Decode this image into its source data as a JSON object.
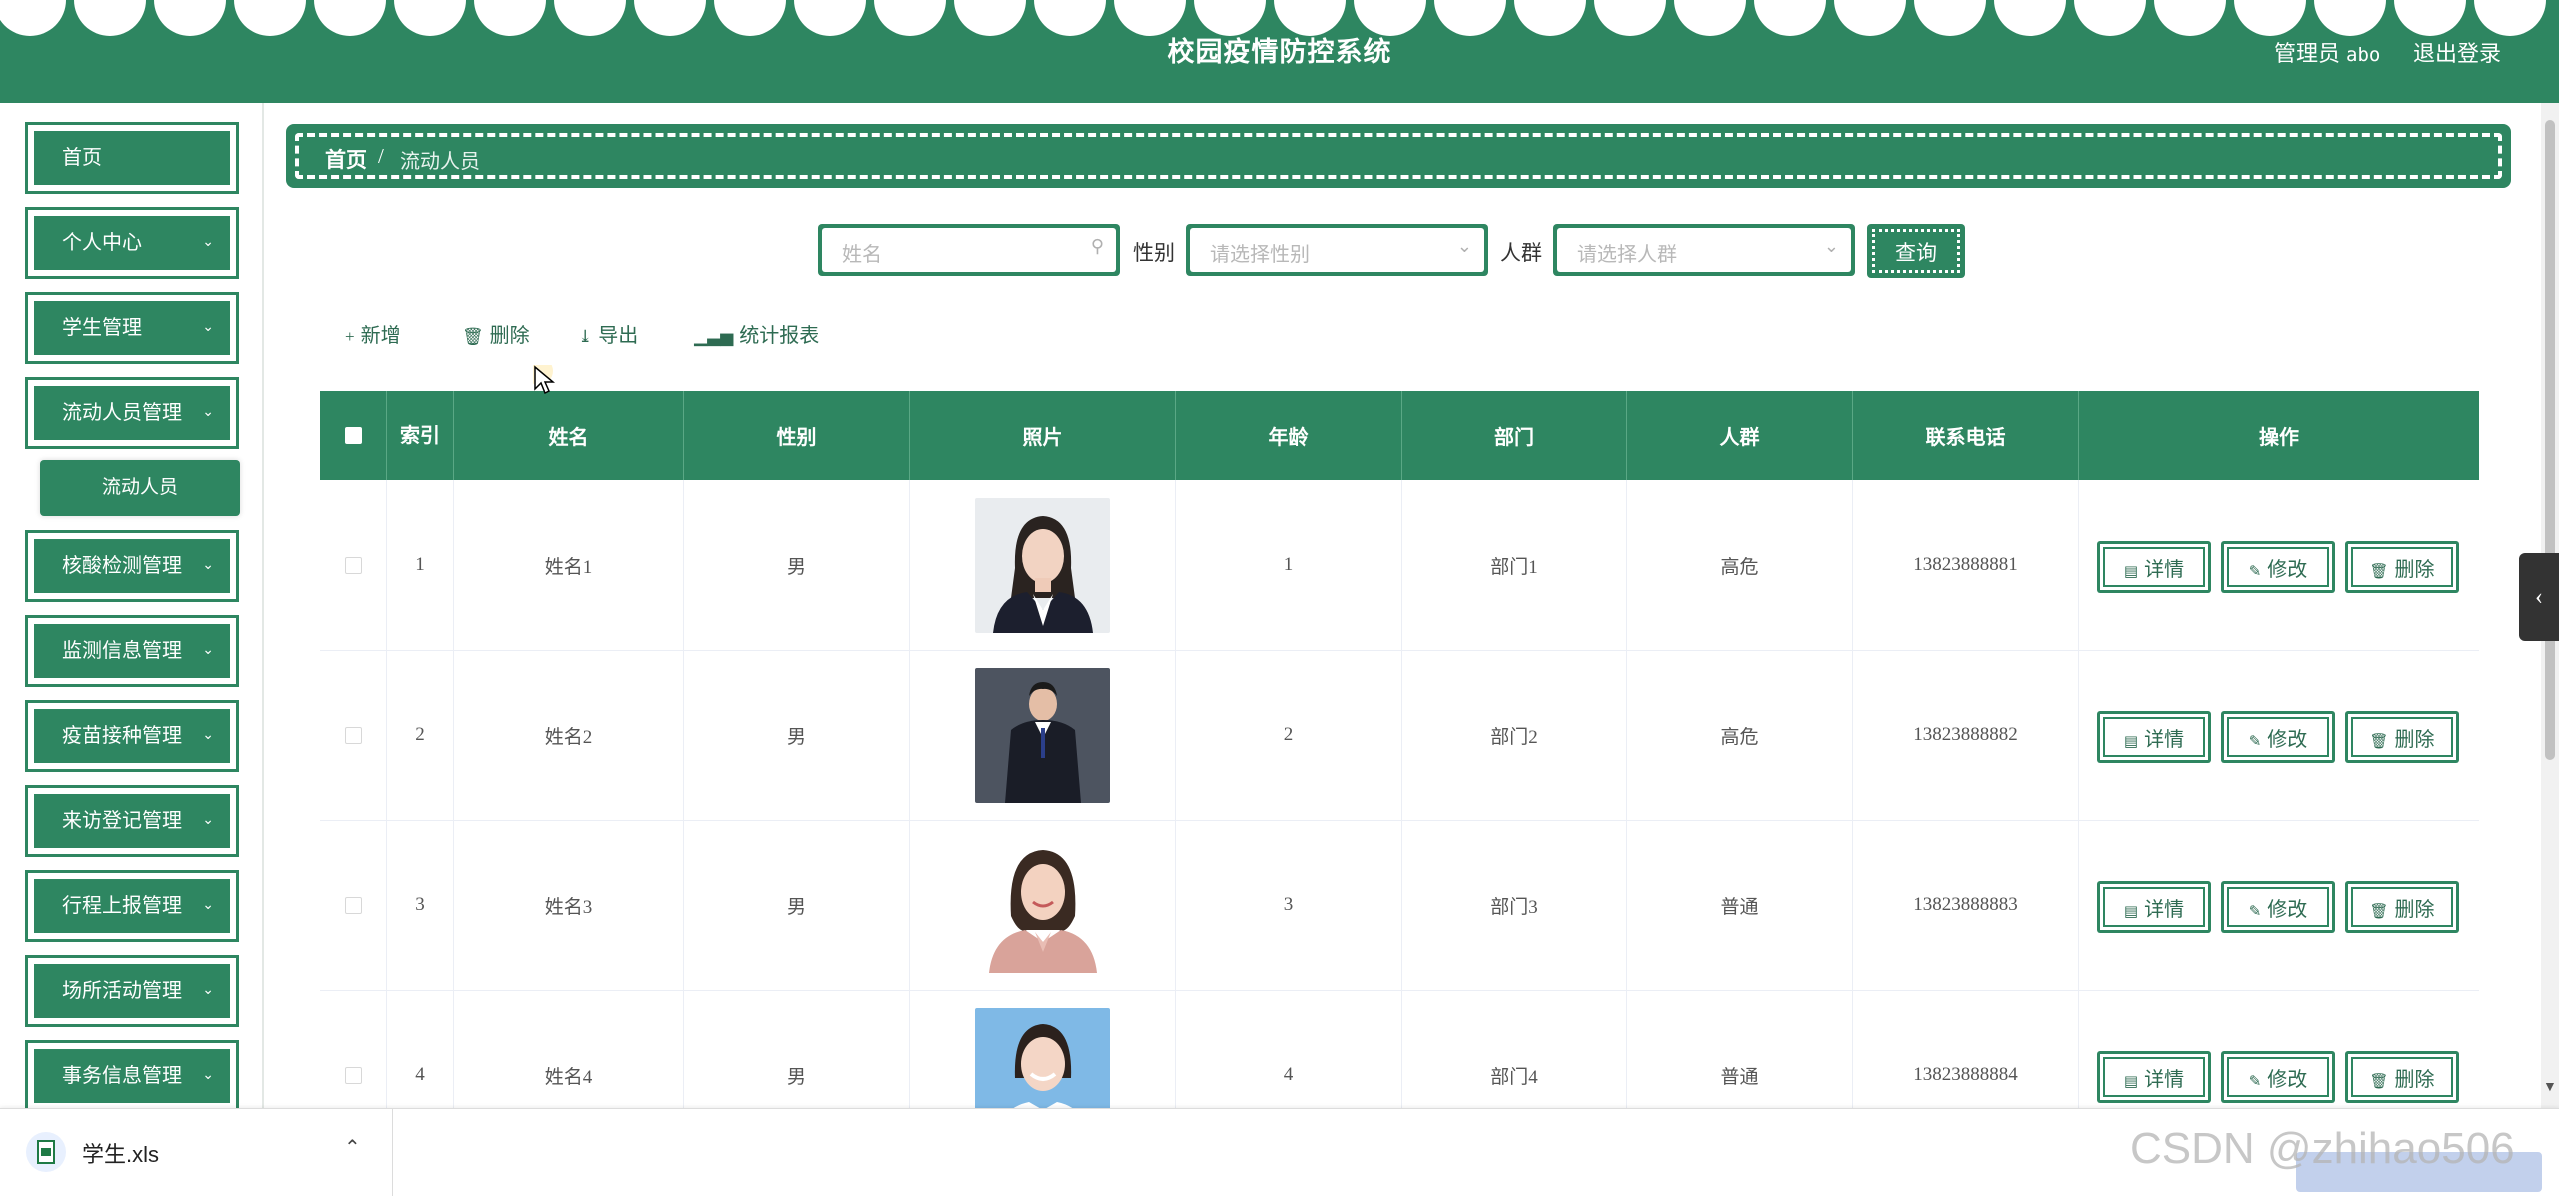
{
  "header": {
    "title": "校园疫情防控系统",
    "admin_label": "管理员",
    "admin_name": "abo",
    "logout": "退出登录"
  },
  "sidebar": {
    "items": [
      {
        "label": "首页",
        "expandable": false
      },
      {
        "label": "个人中心",
        "expandable": true
      },
      {
        "label": "学生管理",
        "expandable": true
      },
      {
        "label": "流动人员管理",
        "expandable": true
      },
      {
        "label": "核酸检测管理",
        "expandable": true
      },
      {
        "label": "监测信息管理",
        "expandable": true
      },
      {
        "label": "疫苗接种管理",
        "expandable": true
      },
      {
        "label": "来访登记管理",
        "expandable": true
      },
      {
        "label": "行程上报管理",
        "expandable": true
      },
      {
        "label": "场所活动管理",
        "expandable": true
      },
      {
        "label": "事务信息管理",
        "expandable": true
      }
    ],
    "subitem": "流动人员"
  },
  "breadcrumb": {
    "home": "首页",
    "separator": "/",
    "current": "流动人员"
  },
  "search": {
    "name_placeholder": "姓名",
    "gender_label": "性别",
    "gender_placeholder": "请选择性别",
    "group_label": "人群",
    "group_placeholder": "请选择人群",
    "query_button": "查询"
  },
  "toolbar": {
    "add": "新增",
    "delete": "删除",
    "export": "导出",
    "report": "统计报表"
  },
  "table": {
    "columns": [
      "",
      "索引",
      "姓名",
      "性别",
      "照片",
      "年龄",
      "部门",
      "人群",
      "联系电话",
      "操作"
    ],
    "index_header_lines": [
      "索",
      "引"
    ],
    "actions": {
      "detail": "详情",
      "edit": "修改",
      "delete": "删除"
    },
    "rows": [
      {
        "index": "1",
        "name": "姓名1",
        "gender": "男",
        "age": "1",
        "department": "部门1",
        "group": "高危",
        "phone": "13823888881"
      },
      {
        "index": "2",
        "name": "姓名2",
        "gender": "男",
        "age": "2",
        "department": "部门2",
        "group": "高危",
        "phone": "13823888882"
      },
      {
        "index": "3",
        "name": "姓名3",
        "gender": "男",
        "age": "3",
        "department": "部门3",
        "group": "普通",
        "phone": "13823888883"
      },
      {
        "index": "4",
        "name": "姓名4",
        "gender": "男",
        "age": "4",
        "department": "部门4",
        "group": "普通",
        "phone": "13823888884"
      }
    ]
  },
  "download": {
    "filename": "学生.xls"
  },
  "watermark": "CSDN @zhihao506",
  "colors": {
    "primary": "#2e8661",
    "text": "#333333"
  }
}
